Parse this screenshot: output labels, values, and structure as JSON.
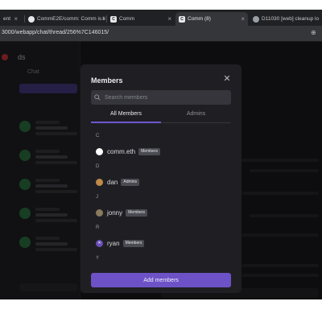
{
  "browser": {
    "tabs": [
      {
        "label": "ent",
        "favicon": "",
        "active": false
      },
      {
        "label": "CommE2E/comm: Comm is li",
        "favicon": "github-icon",
        "active": false
      },
      {
        "label": "Comm",
        "favicon": "comm-icon",
        "active": false
      },
      {
        "label": "Comm (8)",
        "favicon": "comm-icon",
        "active": true
      },
      {
        "label": "D11030 [web] cleanup lo",
        "favicon": "phabricator-icon",
        "active": false
      }
    ],
    "url": "3000/webapp/chat/thread/256%7C146015/"
  },
  "background": {
    "sidebar_title": "ds",
    "sidebar_tab": "Chat"
  },
  "modal": {
    "title": "Members",
    "close_icon": "close-icon",
    "search_placeholder": "Search members",
    "tabs": [
      {
        "label": "All Members",
        "active": true
      },
      {
        "label": "Admins",
        "active": false
      }
    ],
    "groups": [
      {
        "letter": "C",
        "members": [
          {
            "name": "comm.eth",
            "role": "Members",
            "avatar_color": "#ffffff"
          }
        ]
      },
      {
        "letter": "D",
        "members": [
          {
            "name": "dan",
            "role": "Admins",
            "avatar_color": "#c08a4a"
          }
        ]
      },
      {
        "letter": "J",
        "members": [
          {
            "name": "jonny",
            "role": "Members",
            "avatar_color": "#8a7a5e"
          }
        ]
      },
      {
        "letter": "R",
        "members": [
          {
            "name": "ryan",
            "role": "Members",
            "avatar_color": "#6a4fb5"
          }
        ]
      },
      {
        "letter": "Y",
        "members": []
      }
    ],
    "add_button": "Add members"
  },
  "colors": {
    "accent": "#6d52c7",
    "modal_bg": "#1f1f23",
    "app_bg": "#1b1b1f"
  }
}
